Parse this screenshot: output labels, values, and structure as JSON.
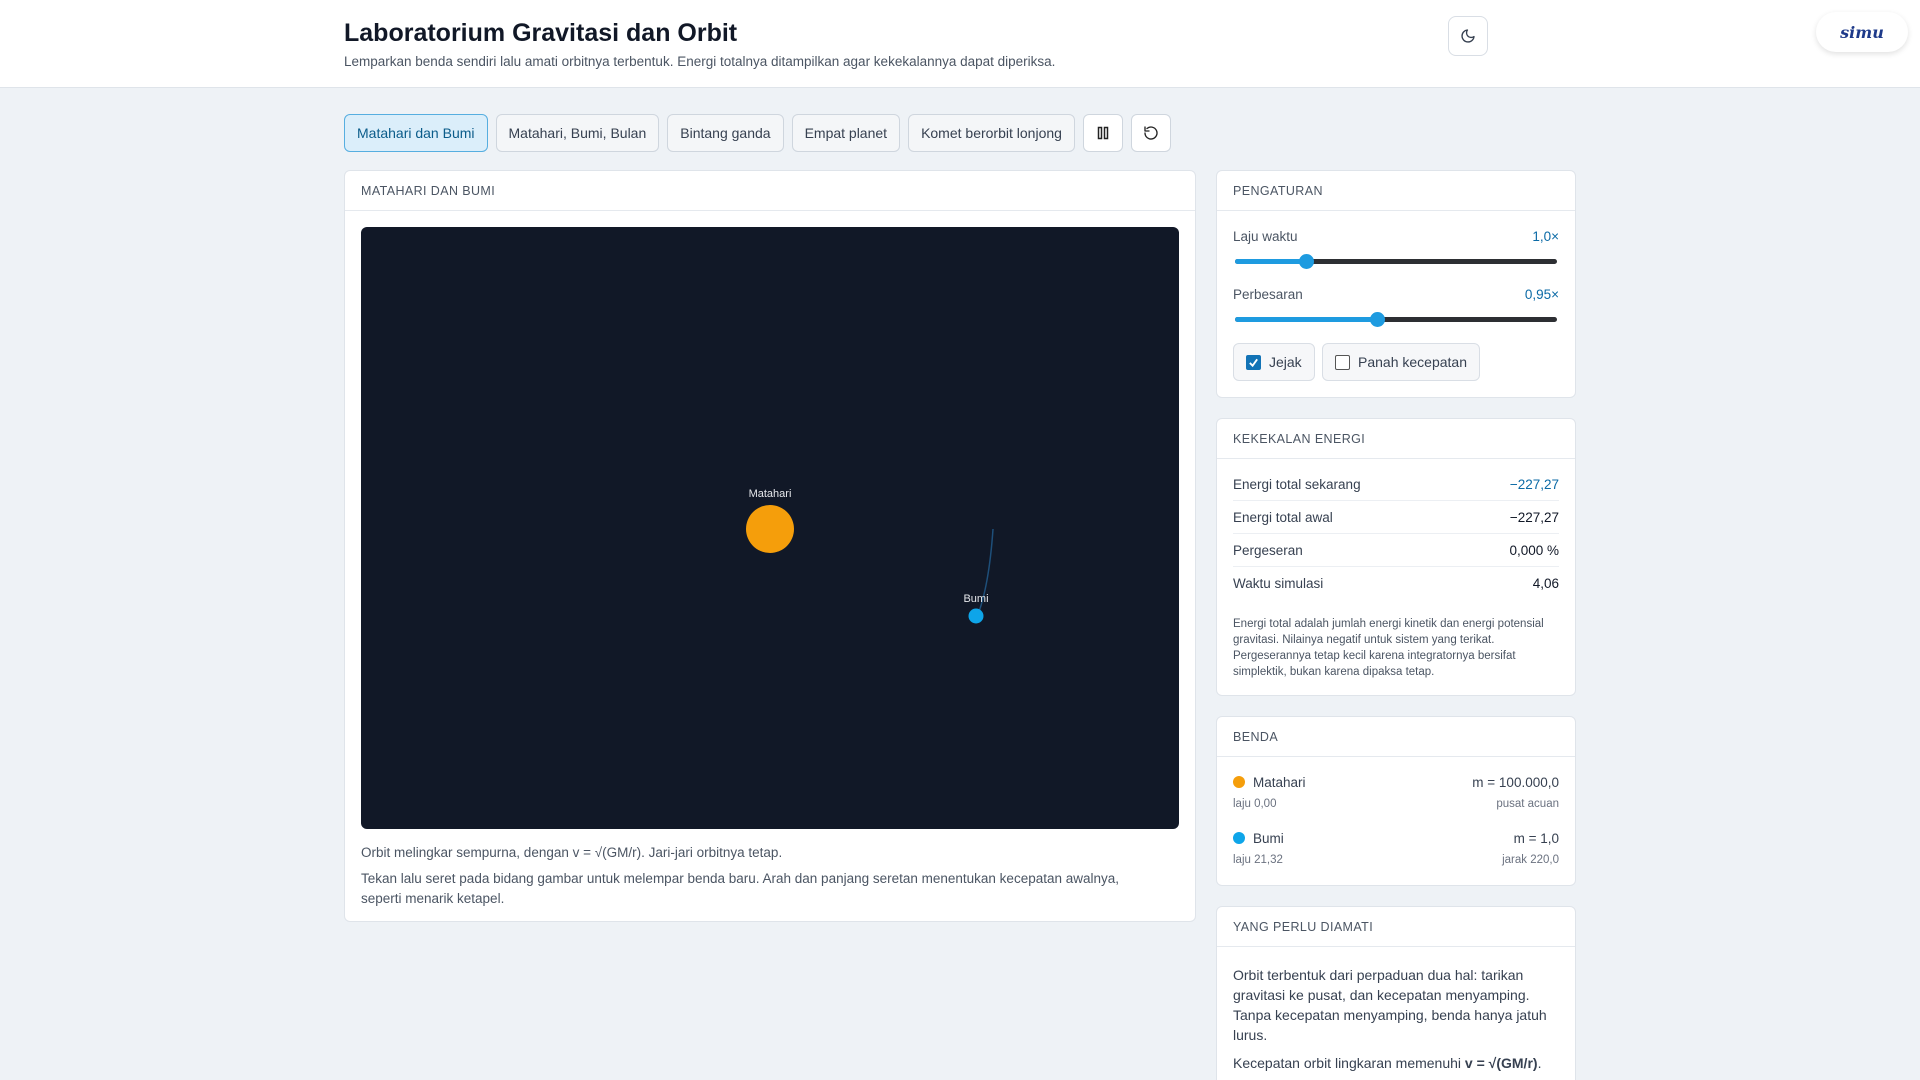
{
  "header": {
    "title": "Laboratorium Gravitasi dan Orbit",
    "subtitle": "Lemparkan benda sendiri lalu amati orbitnya terbentuk. Energi totalnya ditampilkan agar kekekalannya dapat diperiksa.",
    "logo": "simu"
  },
  "presets": [
    {
      "label": "Matahari dan Bumi",
      "active": true
    },
    {
      "label": "Matahari, Bumi, Bulan",
      "active": false
    },
    {
      "label": "Bintang ganda",
      "active": false
    },
    {
      "label": "Empat planet",
      "active": false
    },
    {
      "label": "Komet berorbit lonjong",
      "active": false
    }
  ],
  "simulation": {
    "heading": "Matahari dan Bumi",
    "sun_label": "Matahari",
    "earth_label": "Bumi",
    "caption": "Orbit melingkar sempurna, dengan v = √(GM/r). Jari-jari orbitnya tetap.",
    "hint": "Tekan lalu seret pada bidang gambar untuk melempar benda baru. Arah dan panjang seretan menentukan kecepatan awalnya, seperti menarik ketapel."
  },
  "settings": {
    "heading": "Pengaturan",
    "time_rate_label": "Laju waktu",
    "time_rate_value": "1,0×",
    "time_rate_fraction": 0.22,
    "zoom_label": "Perbesaran",
    "zoom_value": "0,95×",
    "zoom_fraction": 0.44,
    "trail_label": "Jejak",
    "trail_checked": true,
    "velocity_label": "Panah kecepatan",
    "velocity_checked": false
  },
  "energy": {
    "heading": "Kekekalan energi",
    "rows": [
      {
        "label": "Energi total sekarang",
        "value": "−227,27"
      },
      {
        "label": "Energi total awal",
        "value": "−227,27"
      },
      {
        "label": "Pergeseran",
        "value": "0,000 %"
      },
      {
        "label": "Waktu simulasi",
        "value": "4,06"
      }
    ],
    "note": "Energi total adalah jumlah energi kinetik dan energi potensial gravitasi. Nilainya negatif untuk sistem yang terikat. Pergeserannya tetap kecil karena integratornya bersifat simplektik, bukan karena dipaksa tetap."
  },
  "bodies": {
    "heading": "Benda",
    "items": [
      {
        "name": "Matahari",
        "mass": "m = 100.000,0",
        "speed": "laju 0,00",
        "extra": "pusat acuan",
        "color": "#f59e0b"
      },
      {
        "name": "Bumi",
        "mass": "m = 1,0",
        "speed": "laju 21,32",
        "extra": "jarak 220,0",
        "color": "#0ea5e9"
      }
    ]
  },
  "observe": {
    "heading": "Yang perlu diamati",
    "p1": "Orbit terbentuk dari perpaduan dua hal: tarikan gravitasi ke pusat, dan kecepatan menyamping. Tanpa kecepatan menyamping, benda hanya jatuh lurus.",
    "p2_prefix": "Kecepatan orbit lingkaran memenuhi ",
    "p2_formula": "v = √(GM/r)",
    "p2_suffix": "."
  },
  "colors": {
    "accent": "#1e9be0",
    "canvas_bg": "#111827",
    "sun": "#f59e0b",
    "earth": "#0ea5e9"
  }
}
